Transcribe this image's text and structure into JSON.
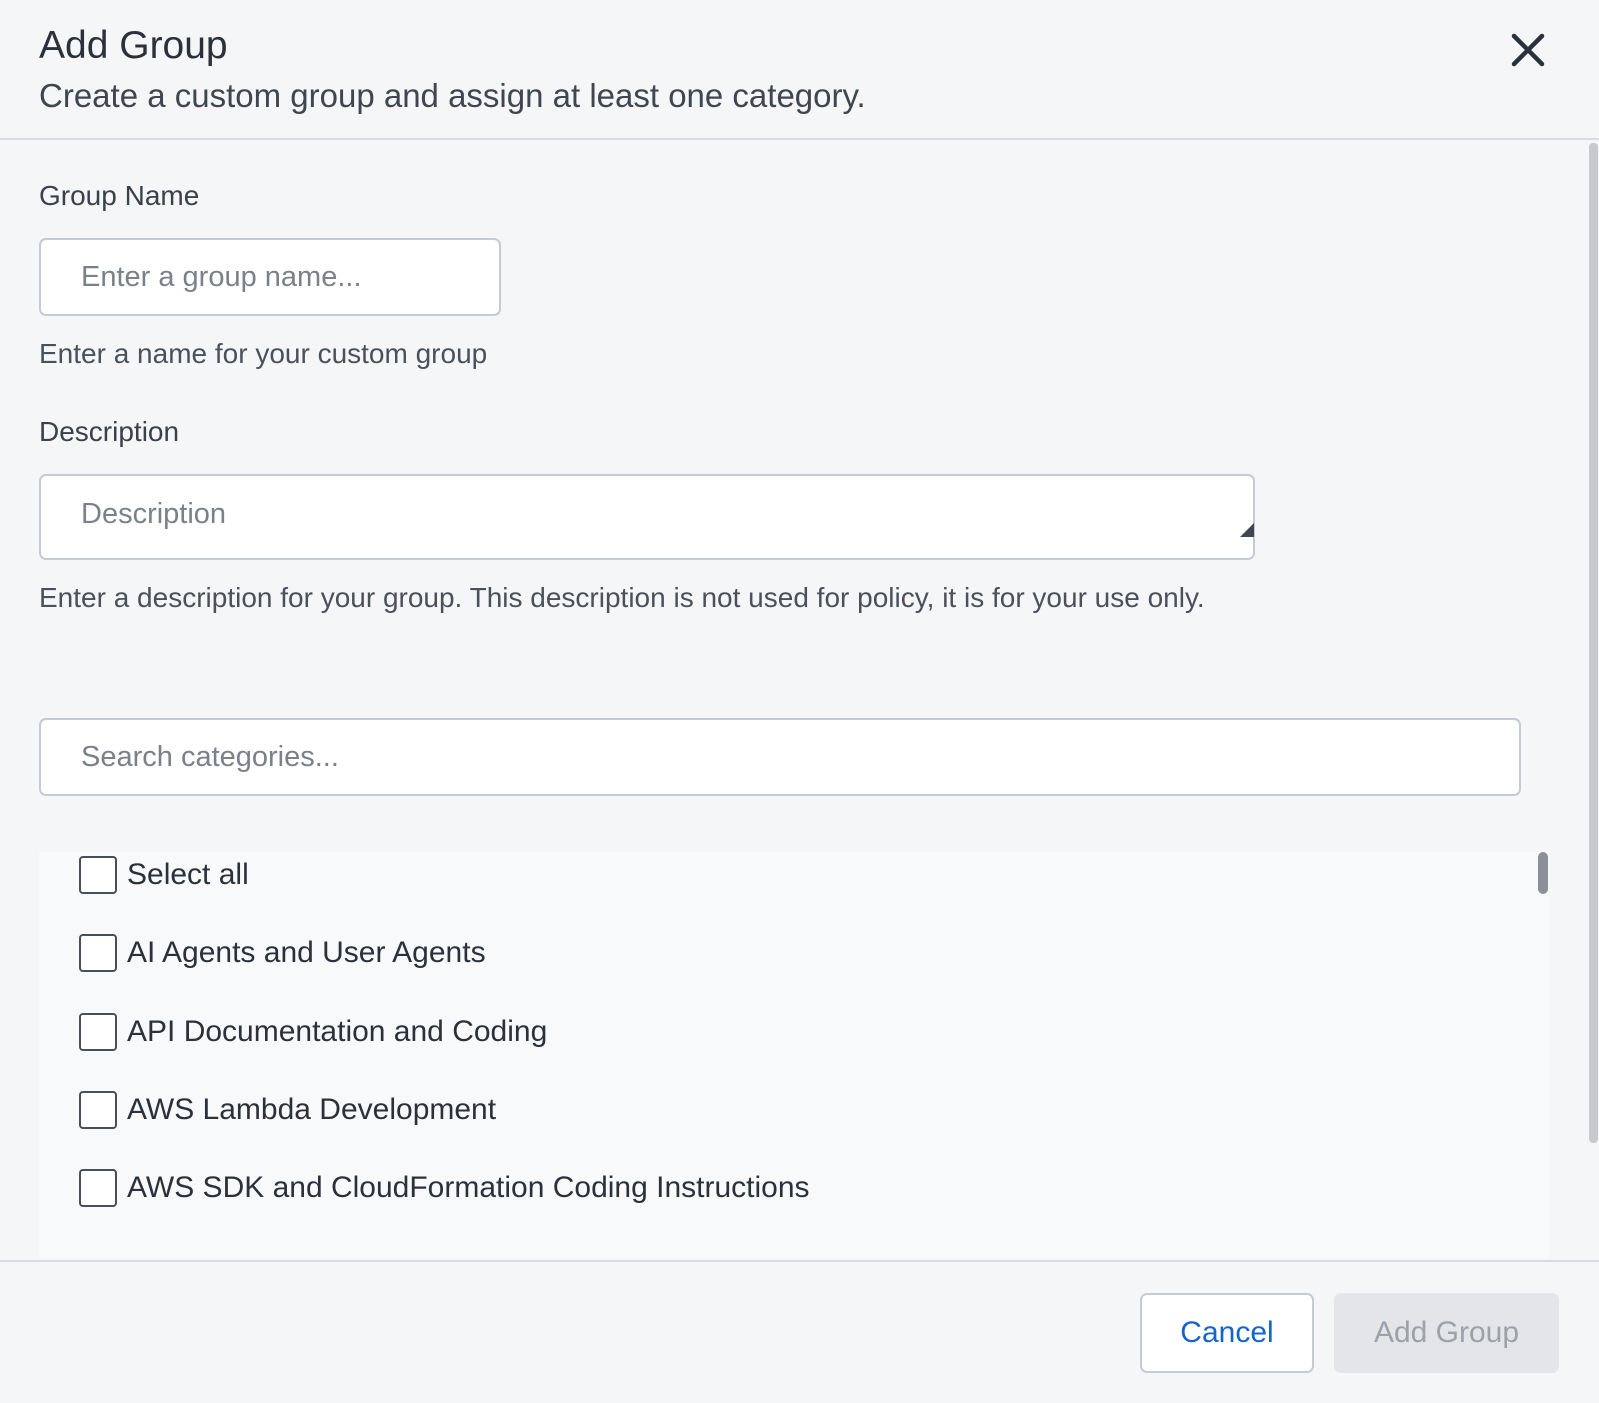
{
  "dialog": {
    "title": "Add Group",
    "subtitle": "Create a custom group and assign at least one category.",
    "close_icon": "close-icon"
  },
  "form": {
    "group_name": {
      "label": "Group Name",
      "placeholder": "Enter a group name...",
      "value": "",
      "helper": "Enter a name for your custom group"
    },
    "description": {
      "label": "Description",
      "placeholder": "Description",
      "value": "",
      "helper": "Enter a description for your group. This description is not used for policy, it is for your use only."
    },
    "search": {
      "placeholder": "Search categories...",
      "value": ""
    }
  },
  "categories": {
    "select_all_label": "Select all",
    "items": [
      {
        "label": "AI Agents and User Agents",
        "checked": false
      },
      {
        "label": "API Documentation and Coding",
        "checked": false
      },
      {
        "label": "AWS Lambda Development",
        "checked": false
      },
      {
        "label": "AWS SDK and CloudFormation Coding Instructions",
        "checked": false
      }
    ]
  },
  "footer": {
    "cancel_label": "Cancel",
    "add_label": "Add Group"
  },
  "colors": {
    "primary_link": "#1366c6",
    "disabled_bg": "#e3e5e8",
    "disabled_text": "#9da2a9",
    "background": "#f5f6f8"
  }
}
